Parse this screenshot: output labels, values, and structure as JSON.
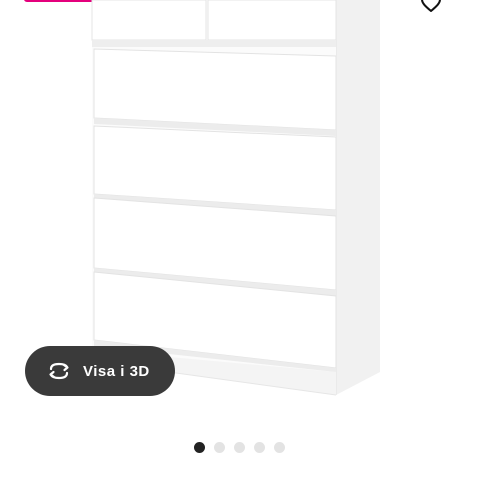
{
  "view3d": {
    "label": "Visa i 3D",
    "icon": "rotate-3d-icon"
  },
  "carousel": {
    "total": 5,
    "active_index": 0
  },
  "colors": {
    "badge": "#e4007c",
    "button_bg": "#3a3a3a",
    "dot_active": "#222222",
    "dot_inactive": "#e3e3e3"
  },
  "icons": {
    "favorite": "heart-icon"
  }
}
